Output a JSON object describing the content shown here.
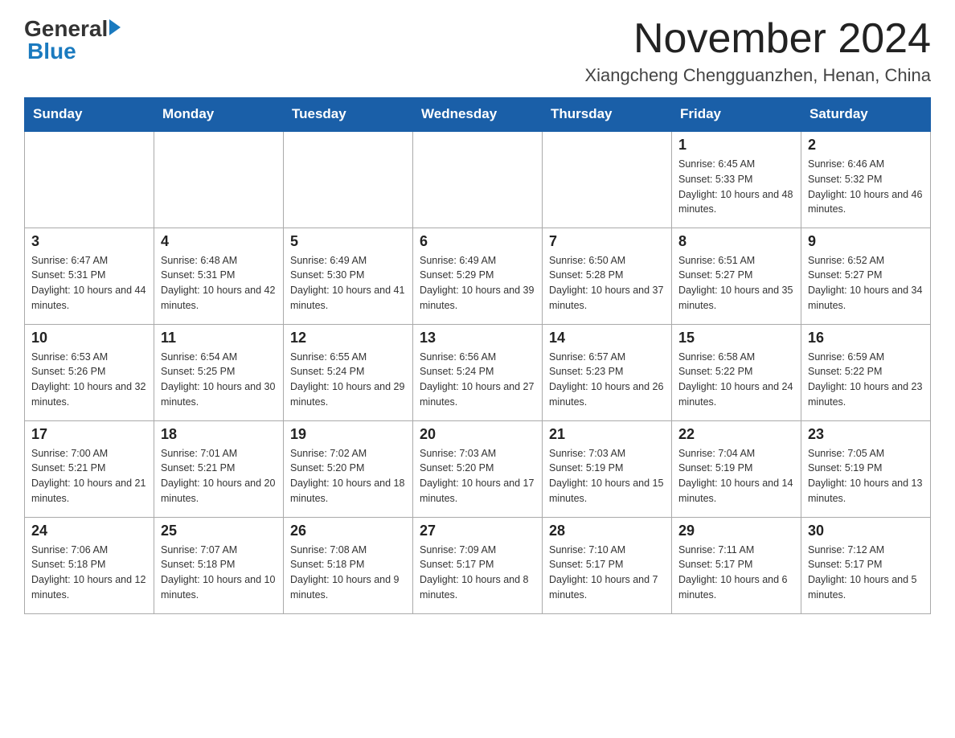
{
  "header": {
    "logo_general": "General",
    "logo_blue": "Blue",
    "month_title": "November 2024",
    "location": "Xiangcheng Chengguanzhen, Henan, China"
  },
  "days_of_week": [
    "Sunday",
    "Monday",
    "Tuesday",
    "Wednesday",
    "Thursday",
    "Friday",
    "Saturday"
  ],
  "weeks": [
    [
      {
        "day": "",
        "sunrise": "",
        "sunset": "",
        "daylight": ""
      },
      {
        "day": "",
        "sunrise": "",
        "sunset": "",
        "daylight": ""
      },
      {
        "day": "",
        "sunrise": "",
        "sunset": "",
        "daylight": ""
      },
      {
        "day": "",
        "sunrise": "",
        "sunset": "",
        "daylight": ""
      },
      {
        "day": "",
        "sunrise": "",
        "sunset": "",
        "daylight": ""
      },
      {
        "day": "1",
        "sunrise": "Sunrise: 6:45 AM",
        "sunset": "Sunset: 5:33 PM",
        "daylight": "Daylight: 10 hours and 48 minutes."
      },
      {
        "day": "2",
        "sunrise": "Sunrise: 6:46 AM",
        "sunset": "Sunset: 5:32 PM",
        "daylight": "Daylight: 10 hours and 46 minutes."
      }
    ],
    [
      {
        "day": "3",
        "sunrise": "Sunrise: 6:47 AM",
        "sunset": "Sunset: 5:31 PM",
        "daylight": "Daylight: 10 hours and 44 minutes."
      },
      {
        "day": "4",
        "sunrise": "Sunrise: 6:48 AM",
        "sunset": "Sunset: 5:31 PM",
        "daylight": "Daylight: 10 hours and 42 minutes."
      },
      {
        "day": "5",
        "sunrise": "Sunrise: 6:49 AM",
        "sunset": "Sunset: 5:30 PM",
        "daylight": "Daylight: 10 hours and 41 minutes."
      },
      {
        "day": "6",
        "sunrise": "Sunrise: 6:49 AM",
        "sunset": "Sunset: 5:29 PM",
        "daylight": "Daylight: 10 hours and 39 minutes."
      },
      {
        "day": "7",
        "sunrise": "Sunrise: 6:50 AM",
        "sunset": "Sunset: 5:28 PM",
        "daylight": "Daylight: 10 hours and 37 minutes."
      },
      {
        "day": "8",
        "sunrise": "Sunrise: 6:51 AM",
        "sunset": "Sunset: 5:27 PM",
        "daylight": "Daylight: 10 hours and 35 minutes."
      },
      {
        "day": "9",
        "sunrise": "Sunrise: 6:52 AM",
        "sunset": "Sunset: 5:27 PM",
        "daylight": "Daylight: 10 hours and 34 minutes."
      }
    ],
    [
      {
        "day": "10",
        "sunrise": "Sunrise: 6:53 AM",
        "sunset": "Sunset: 5:26 PM",
        "daylight": "Daylight: 10 hours and 32 minutes."
      },
      {
        "day": "11",
        "sunrise": "Sunrise: 6:54 AM",
        "sunset": "Sunset: 5:25 PM",
        "daylight": "Daylight: 10 hours and 30 minutes."
      },
      {
        "day": "12",
        "sunrise": "Sunrise: 6:55 AM",
        "sunset": "Sunset: 5:24 PM",
        "daylight": "Daylight: 10 hours and 29 minutes."
      },
      {
        "day": "13",
        "sunrise": "Sunrise: 6:56 AM",
        "sunset": "Sunset: 5:24 PM",
        "daylight": "Daylight: 10 hours and 27 minutes."
      },
      {
        "day": "14",
        "sunrise": "Sunrise: 6:57 AM",
        "sunset": "Sunset: 5:23 PM",
        "daylight": "Daylight: 10 hours and 26 minutes."
      },
      {
        "day": "15",
        "sunrise": "Sunrise: 6:58 AM",
        "sunset": "Sunset: 5:22 PM",
        "daylight": "Daylight: 10 hours and 24 minutes."
      },
      {
        "day": "16",
        "sunrise": "Sunrise: 6:59 AM",
        "sunset": "Sunset: 5:22 PM",
        "daylight": "Daylight: 10 hours and 23 minutes."
      }
    ],
    [
      {
        "day": "17",
        "sunrise": "Sunrise: 7:00 AM",
        "sunset": "Sunset: 5:21 PM",
        "daylight": "Daylight: 10 hours and 21 minutes."
      },
      {
        "day": "18",
        "sunrise": "Sunrise: 7:01 AM",
        "sunset": "Sunset: 5:21 PM",
        "daylight": "Daylight: 10 hours and 20 minutes."
      },
      {
        "day": "19",
        "sunrise": "Sunrise: 7:02 AM",
        "sunset": "Sunset: 5:20 PM",
        "daylight": "Daylight: 10 hours and 18 minutes."
      },
      {
        "day": "20",
        "sunrise": "Sunrise: 7:03 AM",
        "sunset": "Sunset: 5:20 PM",
        "daylight": "Daylight: 10 hours and 17 minutes."
      },
      {
        "day": "21",
        "sunrise": "Sunrise: 7:03 AM",
        "sunset": "Sunset: 5:19 PM",
        "daylight": "Daylight: 10 hours and 15 minutes."
      },
      {
        "day": "22",
        "sunrise": "Sunrise: 7:04 AM",
        "sunset": "Sunset: 5:19 PM",
        "daylight": "Daylight: 10 hours and 14 minutes."
      },
      {
        "day": "23",
        "sunrise": "Sunrise: 7:05 AM",
        "sunset": "Sunset: 5:19 PM",
        "daylight": "Daylight: 10 hours and 13 minutes."
      }
    ],
    [
      {
        "day": "24",
        "sunrise": "Sunrise: 7:06 AM",
        "sunset": "Sunset: 5:18 PM",
        "daylight": "Daylight: 10 hours and 12 minutes."
      },
      {
        "day": "25",
        "sunrise": "Sunrise: 7:07 AM",
        "sunset": "Sunset: 5:18 PM",
        "daylight": "Daylight: 10 hours and 10 minutes."
      },
      {
        "day": "26",
        "sunrise": "Sunrise: 7:08 AM",
        "sunset": "Sunset: 5:18 PM",
        "daylight": "Daylight: 10 hours and 9 minutes."
      },
      {
        "day": "27",
        "sunrise": "Sunrise: 7:09 AM",
        "sunset": "Sunset: 5:17 PM",
        "daylight": "Daylight: 10 hours and 8 minutes."
      },
      {
        "day": "28",
        "sunrise": "Sunrise: 7:10 AM",
        "sunset": "Sunset: 5:17 PM",
        "daylight": "Daylight: 10 hours and 7 minutes."
      },
      {
        "day": "29",
        "sunrise": "Sunrise: 7:11 AM",
        "sunset": "Sunset: 5:17 PM",
        "daylight": "Daylight: 10 hours and 6 minutes."
      },
      {
        "day": "30",
        "sunrise": "Sunrise: 7:12 AM",
        "sunset": "Sunset: 5:17 PM",
        "daylight": "Daylight: 10 hours and 5 minutes."
      }
    ]
  ]
}
